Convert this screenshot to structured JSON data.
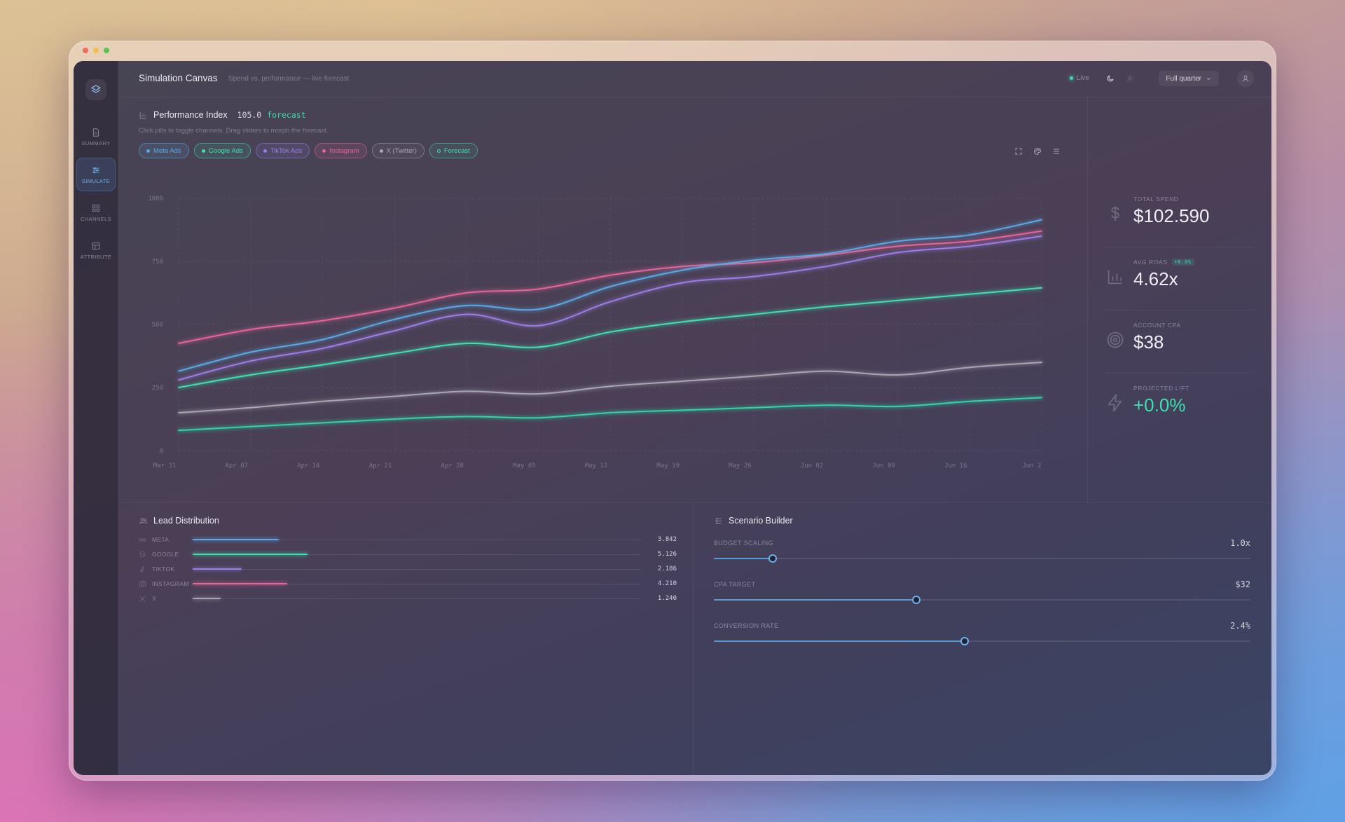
{
  "app": {
    "title": "Simulation Canvas",
    "subtitle": "Spend vs. performance — live forecast"
  },
  "topbar": {
    "live_label": "Live",
    "period_label": "Full quarter",
    "icons": [
      "moon-icon",
      "sun-icon",
      "chevron-down-icon",
      "user-icon"
    ]
  },
  "sidebar": {
    "items": [
      {
        "label": "SUMMARY",
        "icon": "document-icon",
        "active": false
      },
      {
        "label": "SIMULATE",
        "icon": "sliders-icon",
        "active": true
      },
      {
        "label": "CHANNELS",
        "icon": "grid-icon",
        "active": false
      },
      {
        "label": "ATTRIBUTE",
        "icon": "layout-icon",
        "active": false
      }
    ]
  },
  "performance": {
    "title": "Performance Index",
    "value": "105.0",
    "value_suffix": "forecast",
    "hint": "Click pills to toggle channels. Drag sliders to morph the forecast.",
    "pills": [
      {
        "label": "Meta Ads",
        "color": "#5aa9e6"
      },
      {
        "label": "Google Ads",
        "color": "#3fe0b0"
      },
      {
        "label": "TikTok Ads",
        "color": "#9b7ee8"
      },
      {
        "label": "Instagram",
        "color": "#e8649a"
      },
      {
        "label": "X (Twitter)",
        "color": "#a9a6b4"
      },
      {
        "label": "Forecast",
        "color": "#3fe0b0"
      }
    ]
  },
  "chart_data": {
    "type": "line",
    "title": "",
    "xlabel": "",
    "ylabel": "",
    "ylim": [
      0,
      1000
    ],
    "yticks": [
      "1000",
      "750",
      "500",
      "250",
      "0"
    ],
    "x": [
      "Mar 31",
      "Apr 07",
      "Apr 14",
      "Apr 21",
      "Apr 28",
      "May 05",
      "May 12",
      "May 19",
      "May 26",
      "Jun 02",
      "Jun 09",
      "Jun 16",
      "Jun 2"
    ],
    "grid": true,
    "series": [
      {
        "color": "#e8649a",
        "values": [
          425,
          480,
          515,
          565,
          625,
          640,
          695,
          730,
          745,
          775,
          810,
          830,
          870
        ]
      },
      {
        "color": "#5aa9e6",
        "values": [
          315,
          390,
          440,
          520,
          575,
          560,
          650,
          715,
          755,
          780,
          830,
          855,
          915
        ]
      },
      {
        "color": "#9b7ee8",
        "values": [
          280,
          355,
          405,
          475,
          540,
          495,
          590,
          665,
          690,
          730,
          785,
          810,
          850
        ]
      },
      {
        "color": "#3fe0b0",
        "values": [
          250,
          300,
          340,
          385,
          425,
          410,
          470,
          510,
          540,
          570,
          595,
          620,
          645
        ]
      },
      {
        "color": "#a9a6b4",
        "values": [
          150,
          170,
          195,
          215,
          235,
          225,
          255,
          275,
          295,
          315,
          300,
          330,
          350
        ]
      },
      {
        "color": "#2fd6a6",
        "values": [
          80,
          95,
          110,
          125,
          135,
          130,
          150,
          160,
          170,
          180,
          175,
          195,
          210
        ]
      }
    ]
  },
  "kpis": [
    {
      "label": "TOTAL SPEND",
      "value": "$102.590",
      "icon": "dollar-icon",
      "color": "#f1eff6",
      "badge": ""
    },
    {
      "label": "AVG ROAS",
      "value": "4.62x",
      "icon": "bar-chart-icon",
      "color": "#f1eff6",
      "badge": "+0.0%"
    },
    {
      "label": "ACCOUNT CPA",
      "value": "$38",
      "icon": "target-icon",
      "color": "#f1eff6",
      "badge": ""
    },
    {
      "label": "PROJECTED LIFT",
      "value": "+0.0%",
      "icon": "bolt-icon",
      "color": "#3fe0b0",
      "badge": ""
    }
  ],
  "lead_distribution": {
    "title": "Lead Distribution",
    "max": 20000,
    "rows": [
      {
        "label": "META",
        "value": "3.842",
        "count": 3842,
        "color": "#5aa9e6",
        "icon": "infinity-icon"
      },
      {
        "label": "GOOGLE",
        "value": "5.126",
        "count": 5126,
        "color": "#3fe0b0",
        "icon": "google-icon"
      },
      {
        "label": "TIKTOK",
        "value": "2.186",
        "count": 2186,
        "color": "#9b7ee8",
        "icon": "tiktok-icon"
      },
      {
        "label": "INSTAGRAM",
        "value": "4.210",
        "count": 4210,
        "color": "#e8649a",
        "icon": "instagram-icon"
      },
      {
        "label": "X",
        "value": "1.240",
        "count": 1240,
        "color": "#a9a6b4",
        "icon": "x-icon"
      }
    ]
  },
  "scenario": {
    "title": "Scenario Builder",
    "sliders": [
      {
        "label": "BUDGET SCALING",
        "value": "1.0x",
        "fraction": 0.11
      },
      {
        "label": "CPA TARGET",
        "value": "$32",
        "fraction": 0.377
      },
      {
        "label": "CONVERSION RATE",
        "value": "2.4%",
        "fraction": 0.467
      }
    ]
  }
}
